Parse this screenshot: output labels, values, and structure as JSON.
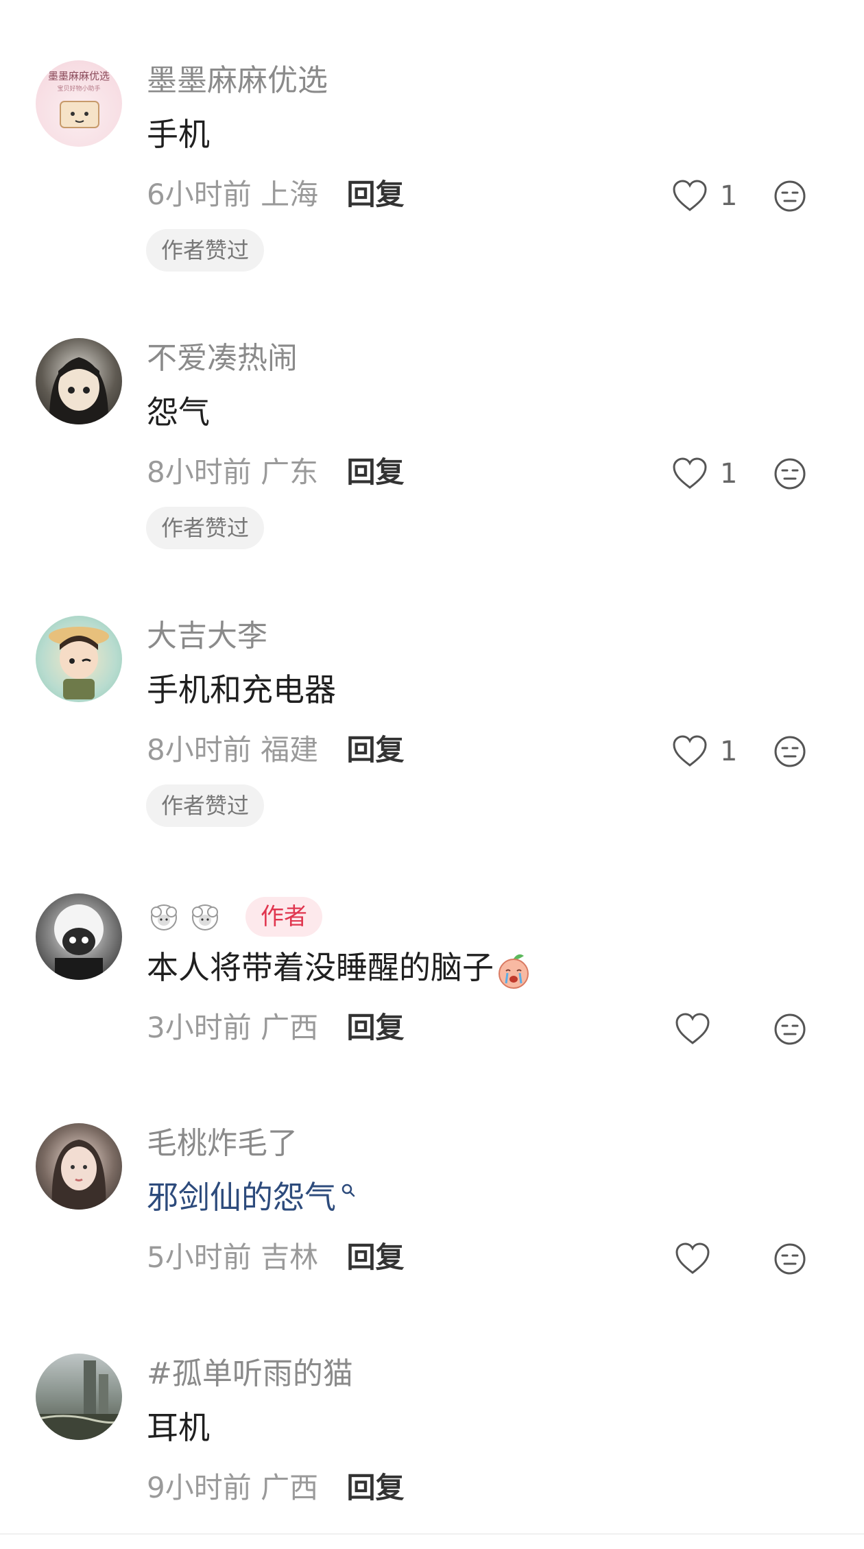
{
  "comments": [
    {
      "username": "墨墨麻麻优选",
      "avatar_text": "墨墨麻麻优选",
      "avatar_subtext": "宝贝好物小助手",
      "content": "手机",
      "time": "6小时前",
      "location": "上海",
      "reply_label": "回复",
      "likes": "1",
      "badge": "作者赞过"
    },
    {
      "username": "不爱凑热闹",
      "content": "怨气",
      "time": "8小时前",
      "location": "广东",
      "reply_label": "回复",
      "likes": "1",
      "badge": "作者赞过"
    },
    {
      "username": "大吉大李",
      "content": "手机和充电器",
      "time": "8小时前",
      "location": "福建",
      "reply_label": "回复",
      "likes": "1",
      "badge": "作者赞过"
    },
    {
      "username_icons": [
        "sheep-emoji",
        "sheep-emoji"
      ],
      "author_tag": "作者",
      "content": "本人将带着没睡醒的脑子",
      "content_emoji": "crying-peach-emoji",
      "time": "3小时前",
      "location": "广西",
      "reply_label": "回复"
    },
    {
      "username": "毛桃炸毛了",
      "content": "邪剑仙的怨气",
      "time": "5小时前",
      "location": "吉林",
      "reply_label": "回复"
    },
    {
      "username": "#孤单听雨的猫",
      "content": "耳机",
      "time": "9小时前",
      "location": "广西",
      "reply_label": "回复"
    }
  ],
  "colors": {
    "username": "#8a8a8a",
    "content": "#1f1f1f",
    "link": "#2d4b7c",
    "author_tag_bg": "#fde9ec",
    "author_tag_text": "#e0364f",
    "badge_bg": "#f2f2f2"
  }
}
